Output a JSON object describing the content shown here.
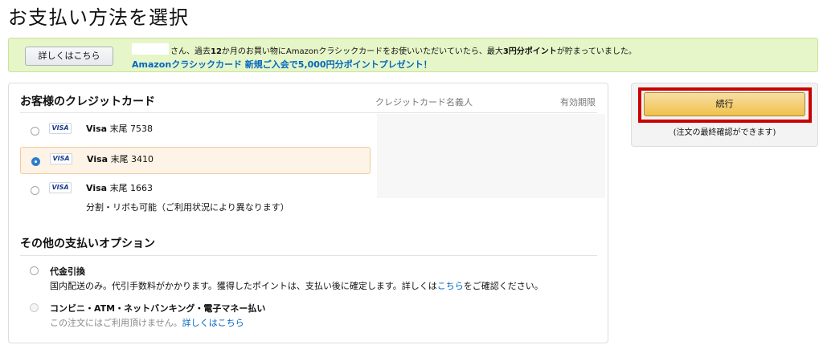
{
  "page": {
    "title": "お支払い方法を選択"
  },
  "promo": {
    "details_button": "詳しくはこちら",
    "message_prefix": "さん、過去",
    "message_bold1": "12",
    "message_mid1": "か月のお買い物にAmazonクラシックカードをお使いいただいていたら、最大",
    "message_bold2": "3円分ポイント",
    "message_suffix": "が貯まっていました。",
    "signup_link": "Amazonクラシックカード 新規ご入会で5,000円分ポイントプレゼント！"
  },
  "cards": {
    "heading": "お客様のクレジットカード",
    "col_name": "クレジットカード名義人",
    "col_expiry": "有効期限",
    "logo_text": "VISA",
    "items": [
      {
        "brand": "Visa",
        "label": "末尾 7538",
        "selected": false
      },
      {
        "brand": "Visa",
        "label": "末尾 3410",
        "selected": true
      },
      {
        "brand": "Visa",
        "label": "末尾 1663",
        "selected": false
      }
    ],
    "note": "分割・リボも可能（ご利用状況により異なります）"
  },
  "other": {
    "heading": "その他の支払いオプション",
    "cod": {
      "title": "代金引換",
      "desc_prefix": "国内配送のみ。代引手数料がかかります。獲得したポイントは、支払い後に確定します。詳しくは",
      "desc_link": "こちら",
      "desc_suffix": "をご確認ください。"
    },
    "convenience": {
      "title": "コンビニ・ATM・ネットバンキング・電子マネー払い",
      "desc": "この注文にはご利用頂けません。",
      "link": "詳しくはこちら"
    }
  },
  "sidebar": {
    "continue_button": "続行",
    "note": "(注文の最終確認ができます)"
  },
  "colors": {
    "accent_link": "#0066c0",
    "highlight_border": "#cc0000",
    "promo_bg": "#e6f6c8",
    "button_gold": "#f0c14b",
    "selected_row_bg": "#fdf3e6"
  }
}
